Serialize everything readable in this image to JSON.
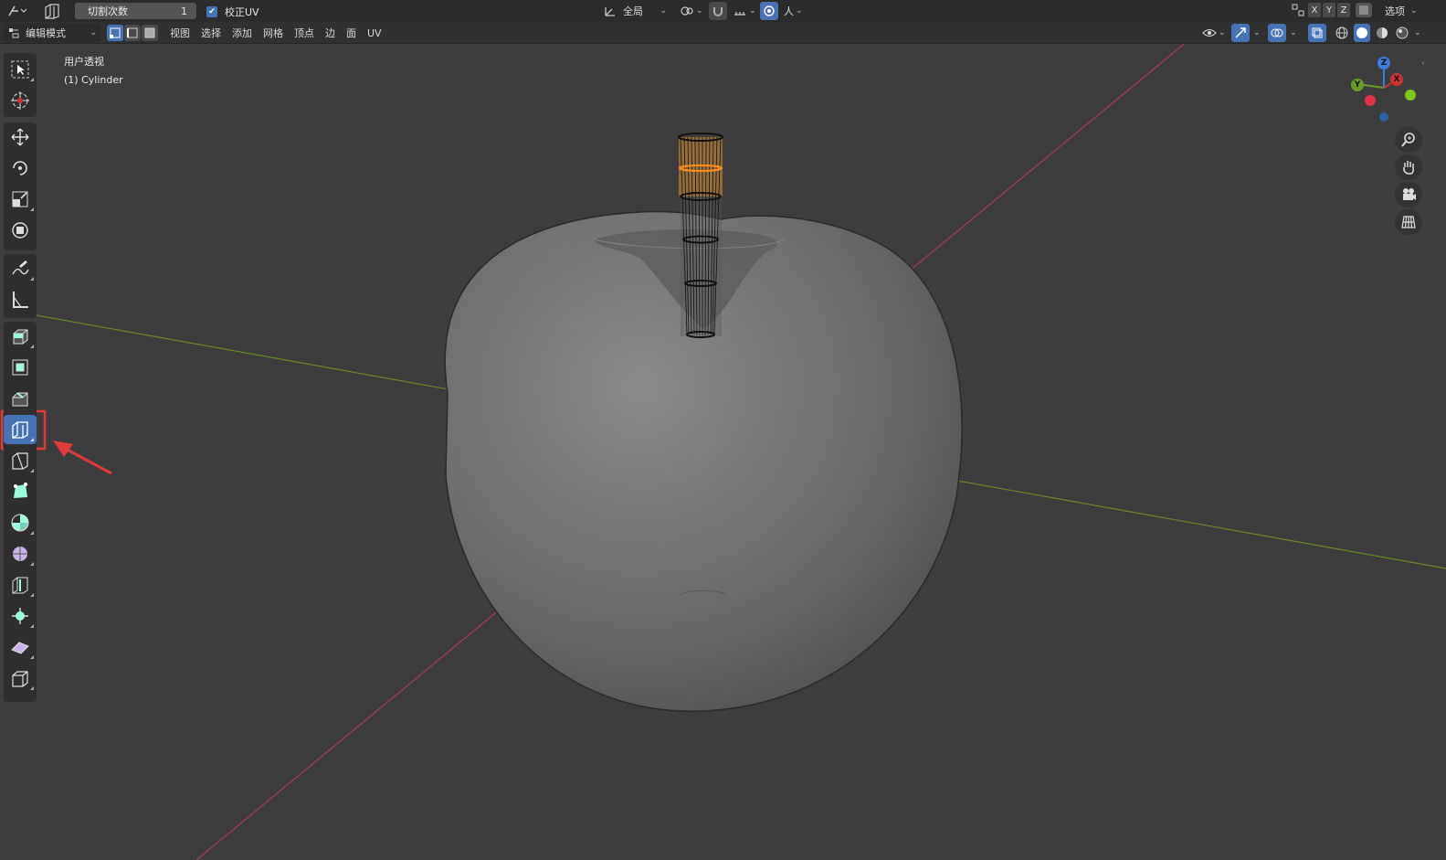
{
  "topbar": {
    "cut_label": "切割次数",
    "cut_value": "1",
    "correct_uv_label": "校正UV",
    "orientation_label": "全局",
    "pivot_label": "人",
    "axes": [
      "X",
      "Y",
      "Z"
    ],
    "options_label": "选项"
  },
  "header": {
    "mode_label": "编辑模式",
    "menus": [
      "视图",
      "选择",
      "添加",
      "网格",
      "顶点",
      "边",
      "面",
      "UV"
    ]
  },
  "viewport": {
    "view_name": "用户透视",
    "object_name": "(1) Cylinder"
  },
  "gizmo": {
    "z_label": "Z",
    "y_label": "Y",
    "x_label": "X"
  },
  "colors": {
    "active_tool": "#4772b3",
    "highlight_box": "#e23a3a",
    "x_axis": "#a8404f",
    "y_axis": "#6a8a2a",
    "selected_edge": "#ff8c1a"
  }
}
